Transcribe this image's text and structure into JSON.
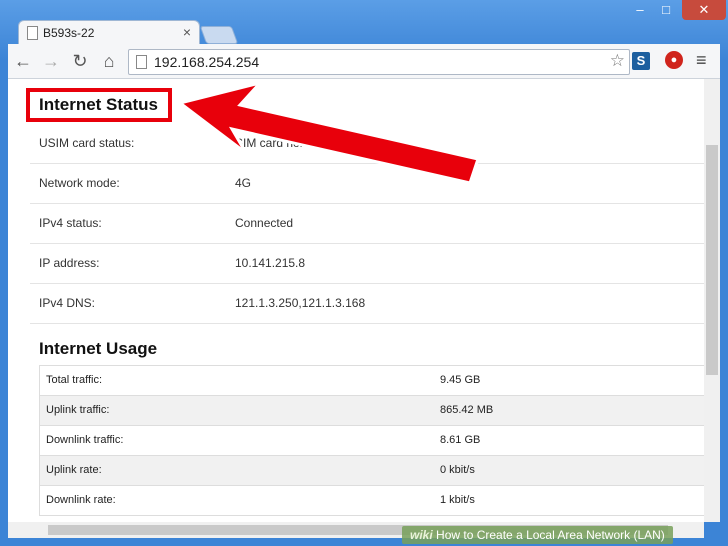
{
  "window": {
    "tab_title": "B593s-22",
    "min": "–",
    "max": "□",
    "close": "✕"
  },
  "toolbar": {
    "back": "←",
    "forward": "→",
    "reload": "↻",
    "home": "⌂",
    "url": "192.168.254.254",
    "star": "☆",
    "ext1": "S",
    "menu": "≡"
  },
  "icons": {
    "back": "back-arrow-icon",
    "forward": "forward-arrow-icon",
    "reload": "reload-icon",
    "home": "home-icon",
    "bookmark": "star-icon",
    "menu": "menu-icon"
  },
  "internet_status": {
    "title": "Internet Status",
    "rows": [
      {
        "label": "USIM card status:",
        "value": "SIM card normal"
      },
      {
        "label": "Network mode:",
        "value": "4G"
      },
      {
        "label": "IPv4 status:",
        "value": "Connected"
      },
      {
        "label": "IP address:",
        "value": "10.141.215.8"
      },
      {
        "label": "IPv4 DNS:",
        "value": "121.1.3.250,121.1.3.168"
      }
    ]
  },
  "internet_usage": {
    "title": "Internet Usage",
    "rows": [
      {
        "label": "Total traffic:",
        "value": "9.45 GB"
      },
      {
        "label": "Uplink traffic:",
        "value": "865.42 MB"
      },
      {
        "label": "Downlink traffic:",
        "value": "8.61 GB"
      },
      {
        "label": "Uplink rate:",
        "value": "0 kbit/s"
      },
      {
        "label": "Downlink rate:",
        "value": "1 kbit/s"
      }
    ]
  },
  "watermark": {
    "brand": "wiki",
    "text": "How to Create a Local Area Network (LAN)"
  },
  "colors": {
    "highlight": "#e8000b",
    "titlebar": "#3c84d6"
  }
}
